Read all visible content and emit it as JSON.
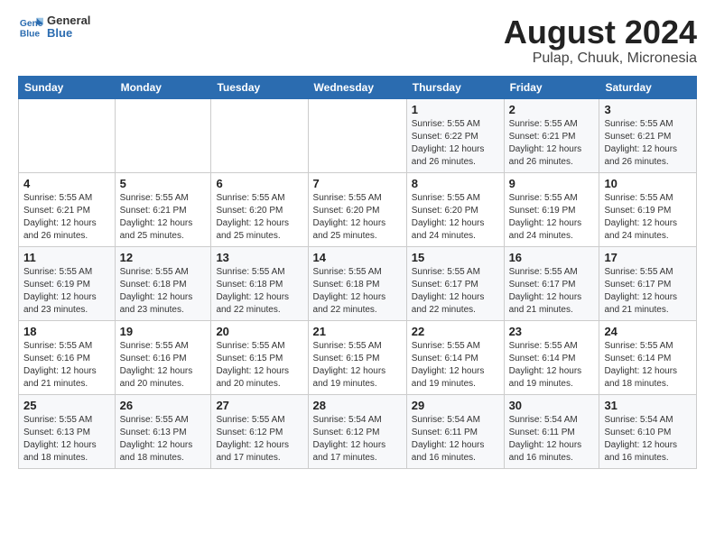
{
  "logo": {
    "line1": "General",
    "line2": "Blue"
  },
  "title": "August 2024",
  "subtitle": "Pulap, Chuuk, Micronesia",
  "days_of_week": [
    "Sunday",
    "Monday",
    "Tuesday",
    "Wednesday",
    "Thursday",
    "Friday",
    "Saturday"
  ],
  "weeks": [
    [
      {
        "day": "",
        "content": ""
      },
      {
        "day": "",
        "content": ""
      },
      {
        "day": "",
        "content": ""
      },
      {
        "day": "",
        "content": ""
      },
      {
        "day": "1",
        "content": "Sunrise: 5:55 AM\nSunset: 6:22 PM\nDaylight: 12 hours\nand 26 minutes."
      },
      {
        "day": "2",
        "content": "Sunrise: 5:55 AM\nSunset: 6:21 PM\nDaylight: 12 hours\nand 26 minutes."
      },
      {
        "day": "3",
        "content": "Sunrise: 5:55 AM\nSunset: 6:21 PM\nDaylight: 12 hours\nand 26 minutes."
      }
    ],
    [
      {
        "day": "4",
        "content": "Sunrise: 5:55 AM\nSunset: 6:21 PM\nDaylight: 12 hours\nand 26 minutes."
      },
      {
        "day": "5",
        "content": "Sunrise: 5:55 AM\nSunset: 6:21 PM\nDaylight: 12 hours\nand 25 minutes."
      },
      {
        "day": "6",
        "content": "Sunrise: 5:55 AM\nSunset: 6:20 PM\nDaylight: 12 hours\nand 25 minutes."
      },
      {
        "day": "7",
        "content": "Sunrise: 5:55 AM\nSunset: 6:20 PM\nDaylight: 12 hours\nand 25 minutes."
      },
      {
        "day": "8",
        "content": "Sunrise: 5:55 AM\nSunset: 6:20 PM\nDaylight: 12 hours\nand 24 minutes."
      },
      {
        "day": "9",
        "content": "Sunrise: 5:55 AM\nSunset: 6:19 PM\nDaylight: 12 hours\nand 24 minutes."
      },
      {
        "day": "10",
        "content": "Sunrise: 5:55 AM\nSunset: 6:19 PM\nDaylight: 12 hours\nand 24 minutes."
      }
    ],
    [
      {
        "day": "11",
        "content": "Sunrise: 5:55 AM\nSunset: 6:19 PM\nDaylight: 12 hours\nand 23 minutes."
      },
      {
        "day": "12",
        "content": "Sunrise: 5:55 AM\nSunset: 6:18 PM\nDaylight: 12 hours\nand 23 minutes."
      },
      {
        "day": "13",
        "content": "Sunrise: 5:55 AM\nSunset: 6:18 PM\nDaylight: 12 hours\nand 22 minutes."
      },
      {
        "day": "14",
        "content": "Sunrise: 5:55 AM\nSunset: 6:18 PM\nDaylight: 12 hours\nand 22 minutes."
      },
      {
        "day": "15",
        "content": "Sunrise: 5:55 AM\nSunset: 6:17 PM\nDaylight: 12 hours\nand 22 minutes."
      },
      {
        "day": "16",
        "content": "Sunrise: 5:55 AM\nSunset: 6:17 PM\nDaylight: 12 hours\nand 21 minutes."
      },
      {
        "day": "17",
        "content": "Sunrise: 5:55 AM\nSunset: 6:17 PM\nDaylight: 12 hours\nand 21 minutes."
      }
    ],
    [
      {
        "day": "18",
        "content": "Sunrise: 5:55 AM\nSunset: 6:16 PM\nDaylight: 12 hours\nand 21 minutes."
      },
      {
        "day": "19",
        "content": "Sunrise: 5:55 AM\nSunset: 6:16 PM\nDaylight: 12 hours\nand 20 minutes."
      },
      {
        "day": "20",
        "content": "Sunrise: 5:55 AM\nSunset: 6:15 PM\nDaylight: 12 hours\nand 20 minutes."
      },
      {
        "day": "21",
        "content": "Sunrise: 5:55 AM\nSunset: 6:15 PM\nDaylight: 12 hours\nand 19 minutes."
      },
      {
        "day": "22",
        "content": "Sunrise: 5:55 AM\nSunset: 6:14 PM\nDaylight: 12 hours\nand 19 minutes."
      },
      {
        "day": "23",
        "content": "Sunrise: 5:55 AM\nSunset: 6:14 PM\nDaylight: 12 hours\nand 19 minutes."
      },
      {
        "day": "24",
        "content": "Sunrise: 5:55 AM\nSunset: 6:14 PM\nDaylight: 12 hours\nand 18 minutes."
      }
    ],
    [
      {
        "day": "25",
        "content": "Sunrise: 5:55 AM\nSunset: 6:13 PM\nDaylight: 12 hours\nand 18 minutes."
      },
      {
        "day": "26",
        "content": "Sunrise: 5:55 AM\nSunset: 6:13 PM\nDaylight: 12 hours\nand 18 minutes."
      },
      {
        "day": "27",
        "content": "Sunrise: 5:55 AM\nSunset: 6:12 PM\nDaylight: 12 hours\nand 17 minutes."
      },
      {
        "day": "28",
        "content": "Sunrise: 5:54 AM\nSunset: 6:12 PM\nDaylight: 12 hours\nand 17 minutes."
      },
      {
        "day": "29",
        "content": "Sunrise: 5:54 AM\nSunset: 6:11 PM\nDaylight: 12 hours\nand 16 minutes."
      },
      {
        "day": "30",
        "content": "Sunrise: 5:54 AM\nSunset: 6:11 PM\nDaylight: 12 hours\nand 16 minutes."
      },
      {
        "day": "31",
        "content": "Sunrise: 5:54 AM\nSunset: 6:10 PM\nDaylight: 12 hours\nand 16 minutes."
      }
    ]
  ]
}
